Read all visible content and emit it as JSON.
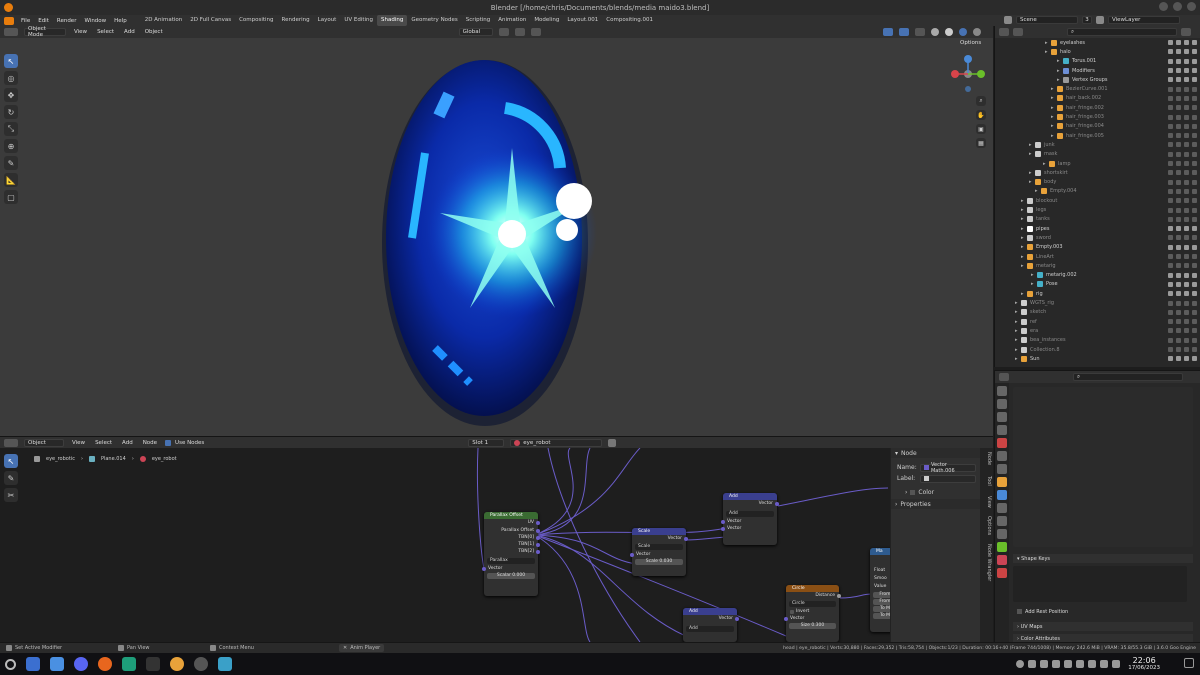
{
  "window": {
    "title": "Blender [/home/chris/Documents/blends/media maido3.blend]"
  },
  "menu": {
    "items": [
      "File",
      "Edit",
      "Render",
      "Window",
      "Help"
    ],
    "workspaces": [
      "2D Animation",
      "2D Full Canvas",
      "Compositing",
      "Rendering",
      "Layout",
      "UV Editing",
      "Shading",
      "Geometry Nodes",
      "Scripting",
      "Animation",
      "Modeling",
      "Layout.001",
      "Compositing.001"
    ],
    "active_workspace": "Shading",
    "scene": "Scene",
    "scene_users": "3",
    "view_layer": "ViewLayer"
  },
  "viewport": {
    "mode": "Object Mode",
    "menus": [
      "View",
      "Select",
      "Add",
      "Object"
    ],
    "orientation": "Global",
    "options": "Options"
  },
  "node_editor": {
    "type": "Object",
    "menus": [
      "View",
      "Select",
      "Add",
      "Node"
    ],
    "use_nodes": "Use Nodes",
    "slot": "Slot 1",
    "material": "eye_robot",
    "breadcrumb": [
      "eye_robotic",
      "Plane.014",
      "eye_robot"
    ],
    "nodes": {
      "parallax": {
        "title": "Parallax Offset",
        "outputs": [
          "UV",
          "Parallax Offset",
          "TBN[0]",
          "TBN[1]",
          "TBN[2]"
        ],
        "image": "Parallax",
        "inputs": [
          "Vector"
        ],
        "scale_label": "Scalar",
        "scale_value": "0.000"
      },
      "scale": {
        "title": "Scale",
        "output": "Vector",
        "operation": "Scale",
        "input": "Vector",
        "scale_label": "Scale",
        "scale_value": "0.030"
      },
      "add1": {
        "title": "Add",
        "output": "Vector",
        "operation": "Add",
        "inputs": [
          "Vector",
          "Vector"
        ]
      },
      "add2": {
        "title": "Add",
        "output": "Vector",
        "operation": "Add"
      },
      "circle": {
        "title": "Circle",
        "output": "Distance",
        "operation": "Circle",
        "invert": "Invert",
        "input": "Vector",
        "size_label": "Size",
        "size_value": "0.300"
      },
      "map": {
        "title": "Ma",
        "outputs": [
          "Float"
        ],
        "smooth": "Smoo",
        "value": "Value",
        "rows": [
          "From",
          "From",
          "To M",
          "To M"
        ]
      }
    },
    "panel": {
      "section": "Node",
      "name_label": "Name:",
      "name_value": "Vector Math.006",
      "label_label": "Label:",
      "color": "Color",
      "properties": "Properties"
    },
    "side_tabs": [
      "Node",
      "Tool",
      "View",
      "Options",
      "Node Wrangler"
    ]
  },
  "outliner": {
    "rows": [
      {
        "name": "eyelashes",
        "dim": false,
        "indent": 50,
        "color": "#e8a23a"
      },
      {
        "name": "halo",
        "dim": false,
        "indent": 50,
        "color": "#e8a23a"
      },
      {
        "name": "Torus.001",
        "dim": false,
        "indent": 62,
        "color": "#45b0c8"
      },
      {
        "name": "Modifiers",
        "dim": false,
        "indent": 62,
        "color": "#6d8fd6"
      },
      {
        "name": "Vertex Groups",
        "dim": false,
        "indent": 62,
        "color": "#9a9a9a"
      },
      {
        "name": "BezierCurve.001",
        "dim": true,
        "indent": 56,
        "color": "#e8a23a"
      },
      {
        "name": "hair_back.002",
        "dim": true,
        "indent": 56,
        "color": "#e8a23a"
      },
      {
        "name": "hair_fringe.002",
        "dim": true,
        "indent": 56,
        "color": "#e8a23a"
      },
      {
        "name": "hair_fringe.003",
        "dim": true,
        "indent": 56,
        "color": "#e8a23a"
      },
      {
        "name": "hair_fringe.004",
        "dim": true,
        "indent": 56,
        "color": "#e8a23a"
      },
      {
        "name": "hair_fringe.005",
        "dim": true,
        "indent": 56,
        "color": "#e8a23a"
      },
      {
        "name": "junk",
        "dim": true,
        "indent": 34,
        "color": "#cccccc"
      },
      {
        "name": "mask",
        "dim": true,
        "indent": 34,
        "color": "#cccccc"
      },
      {
        "name": "lamp",
        "dim": true,
        "indent": 48,
        "color": "#e8a23a"
      },
      {
        "name": "shortskirt",
        "dim": true,
        "indent": 34,
        "color": "#cccccc"
      },
      {
        "name": "body",
        "dim": true,
        "indent": 34,
        "color": "#e8a23a"
      },
      {
        "name": "Empty.004",
        "dim": true,
        "indent": 40,
        "color": "#e8a23a"
      },
      {
        "name": "blockout",
        "dim": true,
        "indent": 26,
        "color": "#cccccc"
      },
      {
        "name": "legs",
        "dim": true,
        "indent": 26,
        "color": "#cccccc"
      },
      {
        "name": "tanks",
        "dim": true,
        "indent": 26,
        "color": "#cccccc"
      },
      {
        "name": "pipes",
        "dim": false,
        "indent": 26,
        "color": "#ffffff"
      },
      {
        "name": "sword",
        "dim": true,
        "indent": 26,
        "color": "#cccccc"
      },
      {
        "name": "Empty.003",
        "dim": false,
        "indent": 26,
        "color": "#e8a23a"
      },
      {
        "name": "LineArt",
        "dim": true,
        "indent": 26,
        "color": "#e8a23a"
      },
      {
        "name": "metarig",
        "dim": true,
        "indent": 26,
        "color": "#e8a23a"
      },
      {
        "name": "metarig.002",
        "dim": false,
        "indent": 36,
        "color": "#45b0c8"
      },
      {
        "name": "Pose",
        "dim": false,
        "indent": 36,
        "color": "#45b0c8"
      },
      {
        "name": "rig",
        "dim": false,
        "indent": 26,
        "color": "#e8a23a"
      },
      {
        "name": "WGTS_rig",
        "dim": true,
        "indent": 20,
        "color": "#cccccc"
      },
      {
        "name": "sketch",
        "dim": true,
        "indent": 20,
        "color": "#cccccc"
      },
      {
        "name": "ref",
        "dim": true,
        "indent": 20,
        "color": "#cccccc"
      },
      {
        "name": "era",
        "dim": true,
        "indent": 20,
        "color": "#cccccc"
      },
      {
        "name": "bea_instances",
        "dim": true,
        "indent": 20,
        "color": "#cccccc"
      },
      {
        "name": "Collection.8",
        "dim": true,
        "indent": 20,
        "color": "#cccccc"
      },
      {
        "name": "Sun",
        "dim": false,
        "indent": 20,
        "color": "#e8a23a"
      }
    ]
  },
  "properties": {
    "shape_keys": "Shape Keys",
    "add_rest": "Add Rest Position",
    "uv_maps": "UV Maps",
    "color_attributes": "Color Attributes"
  },
  "status": {
    "left1": "Set Active Modifier",
    "left2": "Pan View",
    "left3": "Context Menu",
    "anim": "Anim Player",
    "stats": "head | eye_robotic | Verts:30,880 | Faces:29,352 | Tris:58,754 | Objects:1/23 | Duration: 00:16+40 (Frame 744/1008) | Memory: 242.6 MiB | VRAM: 35.8/55.3 GiB | 3.6.0 Goo Engine"
  },
  "taskbar": {
    "time": "22:06",
    "date": "17/06/2023"
  }
}
